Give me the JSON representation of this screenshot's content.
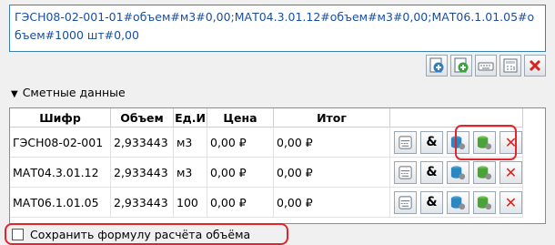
{
  "formula": {
    "value": "ГЭСН08-02-001-01#объем#м3#0,00;МАТ04.3.01.12#объем#м3#0,00;МАТ06.1.01.05#объем#1000 шт#0,00"
  },
  "toolbar": {
    "buttons": [
      "add-blue-icon",
      "add-green-icon",
      "keyboard-icon",
      "calculator-icon",
      "delete-icon"
    ]
  },
  "section": {
    "title": "Сметные данные"
  },
  "grid": {
    "columns": [
      "Шифр",
      "Объем",
      "Ед.И",
      "Цена",
      "Итог"
    ],
    "rows": [
      {
        "code": "ГЭСН08-02-001",
        "volume": "2,933443",
        "unit": "м3",
        "price": "0,00 ₽",
        "total": "0,00 ₽"
      },
      {
        "code": "МАТ04.3.01.12",
        "volume": "2,933443",
        "unit": "м3",
        "price": "0,00 ₽",
        "total": "0,00 ₽"
      },
      {
        "code": "МАТ06.1.01.05",
        "volume": "2,933443",
        "unit": "100",
        "price": "0,00 ₽",
        "total": "0,00 ₽"
      }
    ],
    "row_action_icons": [
      "keyboard-icon",
      "ampersand-icon",
      "database-blue-icon",
      "database-green-icon",
      "delete-icon"
    ],
    "amp_label": "&",
    "delete_label": "✕"
  },
  "save_formula": {
    "label": "Сохранить формулу расчёта объёма",
    "checked": false
  },
  "colors": {
    "highlight": "#e0262c",
    "delete": "#d9241c",
    "formula_text": "#1a4fa0"
  }
}
